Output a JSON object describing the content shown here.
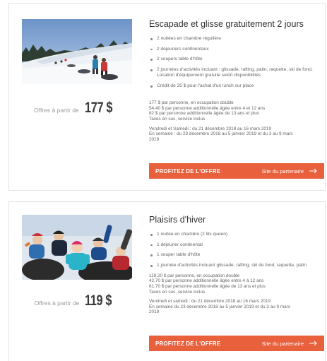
{
  "offers": [
    {
      "title": "Escapade et glisse gratuitement 2 jours",
      "price_label": "Offres à partir de",
      "price_value": "177 $",
      "features": [
        "2 nuitées en chambre régulière",
        "2 déjeuners continentaux",
        "2 soupers table d'hôte",
        "2 journées d'activités incluant : glissade, rafting, patin, raquette, ski de fond. Location d'équipement gratuite selon disponibilités",
        "Crédit de 25 $ pour l'achat d'un lunch sur place"
      ],
      "pricing_lines": [
        "177 $ par personne, en occupation double",
        "54,40 $ par personne additionnelle âgée entre 4 et 12 ans",
        "82 $ par personne additionnelle âgée de 13 ans et plus",
        "Taxes en sus, service inclus"
      ],
      "date_lines": [
        "Vendredi et Samedi : du 21 décembre 2018 au 16 mars 2019",
        "En semaine : du 23 décembre 2018 au 5 janvier 2019 et du 3 au 9 mars",
        "2019"
      ],
      "cta_label": "PROFITEZ DE L'OFFRE",
      "partner_label": "Site du partenaire",
      "image_icon": "snow-tubing-photo"
    },
    {
      "title": "Plaisirs d'hiver",
      "price_label": "Offres à partir de",
      "price_value": "119 $",
      "features": [
        "1 nuitée en chambre (2 lits queen)",
        "1 déjeuner continental",
        "1 souper table d'hôte",
        "1 journée d'activités incluant glissade, rafting, ski de fond, raquette, patin"
      ],
      "pricing_lines": [
        "119,20 $ par personne, en occupation double",
        "42,70 $ par personne additionnelle âgée entre 4 à 12 ans",
        "61,70 $ par personne additionnelle âgée de 13 ans et plus",
        "Taxes en sus, service inclus"
      ],
      "date_lines": [
        "Vendredi et samedi : du 21 décembre 2018 au 16 mars 2019",
        "En semaine du 23 décembre 2018 au 5 janvier 2019 et du 3 au 9 mars",
        "2019"
      ],
      "cta_label": "PROFITEZ DE L'OFFRE",
      "partner_label": "Site du partenaire",
      "image_icon": "kids-sledding-photo"
    }
  ],
  "colors": {
    "accent": "#e8603c",
    "card_border": "#e3e3e3",
    "title_text": "#333333"
  }
}
